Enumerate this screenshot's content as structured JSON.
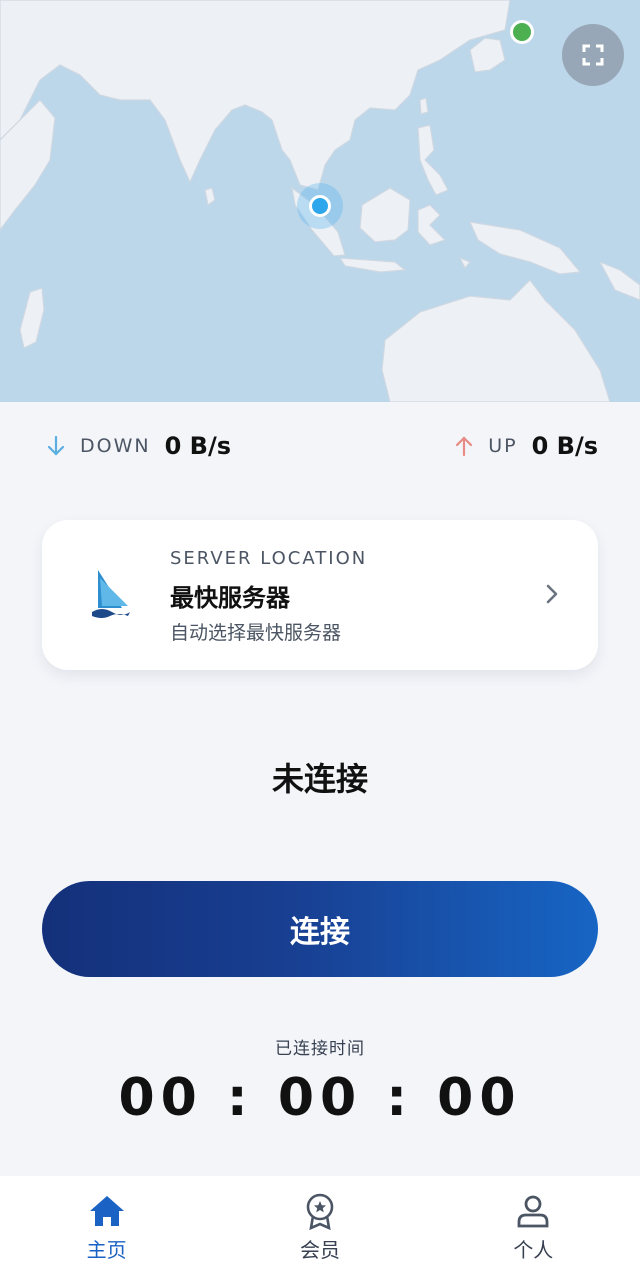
{
  "speed": {
    "down_label": "DOWN",
    "down_value": "0 B/s",
    "up_label": "UP",
    "up_value": "0 B/s",
    "down_color": "#5aaee0",
    "up_color": "#e88a86"
  },
  "server": {
    "caption": "SERVER LOCATION",
    "name": "最快服务器",
    "subtitle": "自动选择最快服务器"
  },
  "status_text": "未连接",
  "connect_button_label": "连接",
  "timer": {
    "label": "已连接时间",
    "value": "00 : 00 : 00"
  },
  "tabs": [
    {
      "label": "主页",
      "icon": "home-icon",
      "active": true
    },
    {
      "label": "会员",
      "icon": "membership-badge-icon",
      "active": false
    },
    {
      "label": "个人",
      "icon": "person-icon",
      "active": false
    }
  ],
  "colors": {
    "accent": "#1a62c4",
    "button_gradient_start": "#14307a",
    "button_gradient_end": "#1765c4",
    "map_water": "#bcd6ea",
    "map_land": "#edf1f5",
    "current_location_dot": "#2ea6ec",
    "server_dot": "#4caf50"
  }
}
